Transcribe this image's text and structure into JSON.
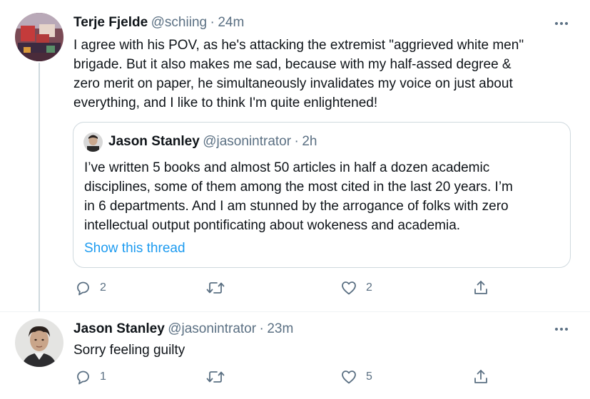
{
  "tweet1": {
    "display_name": "Terje Fjelde",
    "handle": "@schiing",
    "sep": "·",
    "time": "24m",
    "lines": [
      "I agree with his POV, as he's attacking the extremist \"aggrieved white men\"",
      "brigade. But it also makes me sad, because with my half-assed degree &",
      "zero merit on paper, he simultaneously invalidates my voice on just about",
      "everything, and I like to think I'm quite enlightened!"
    ],
    "quote": {
      "display_name": "Jason Stanley",
      "handle": "@jasonintrator",
      "sep": "·",
      "time": "2h",
      "lines": [
        "I’ve written 5 books and almost 50 articles in half a dozen academic",
        "disciplines, some of them among the most cited in the last 20 years. I’m",
        "in 6 departments. And I am stunned by the arrogance of folks with zero",
        "intellectual output pontificating about wokeness and academia."
      ],
      "show_thread": "Show this thread"
    },
    "actions": {
      "reply_count": "2",
      "retweet_count": "",
      "like_count": "2"
    }
  },
  "tweet2": {
    "display_name": "Jason Stanley",
    "handle": "@jasonintrator",
    "sep": "·",
    "time": "23m",
    "text": "Sorry feeling guilty",
    "actions": {
      "reply_count": "1",
      "retweet_count": "",
      "like_count": "5"
    }
  },
  "icons": {
    "reply": "reply-icon",
    "retweet": "retweet-icon",
    "like": "heart-icon",
    "share": "share-icon",
    "more": "more-icon"
  },
  "colors": {
    "accent": "#1d9bf0",
    "muted": "#5b7083",
    "text": "#0f1419",
    "border": "#cfd9de"
  }
}
